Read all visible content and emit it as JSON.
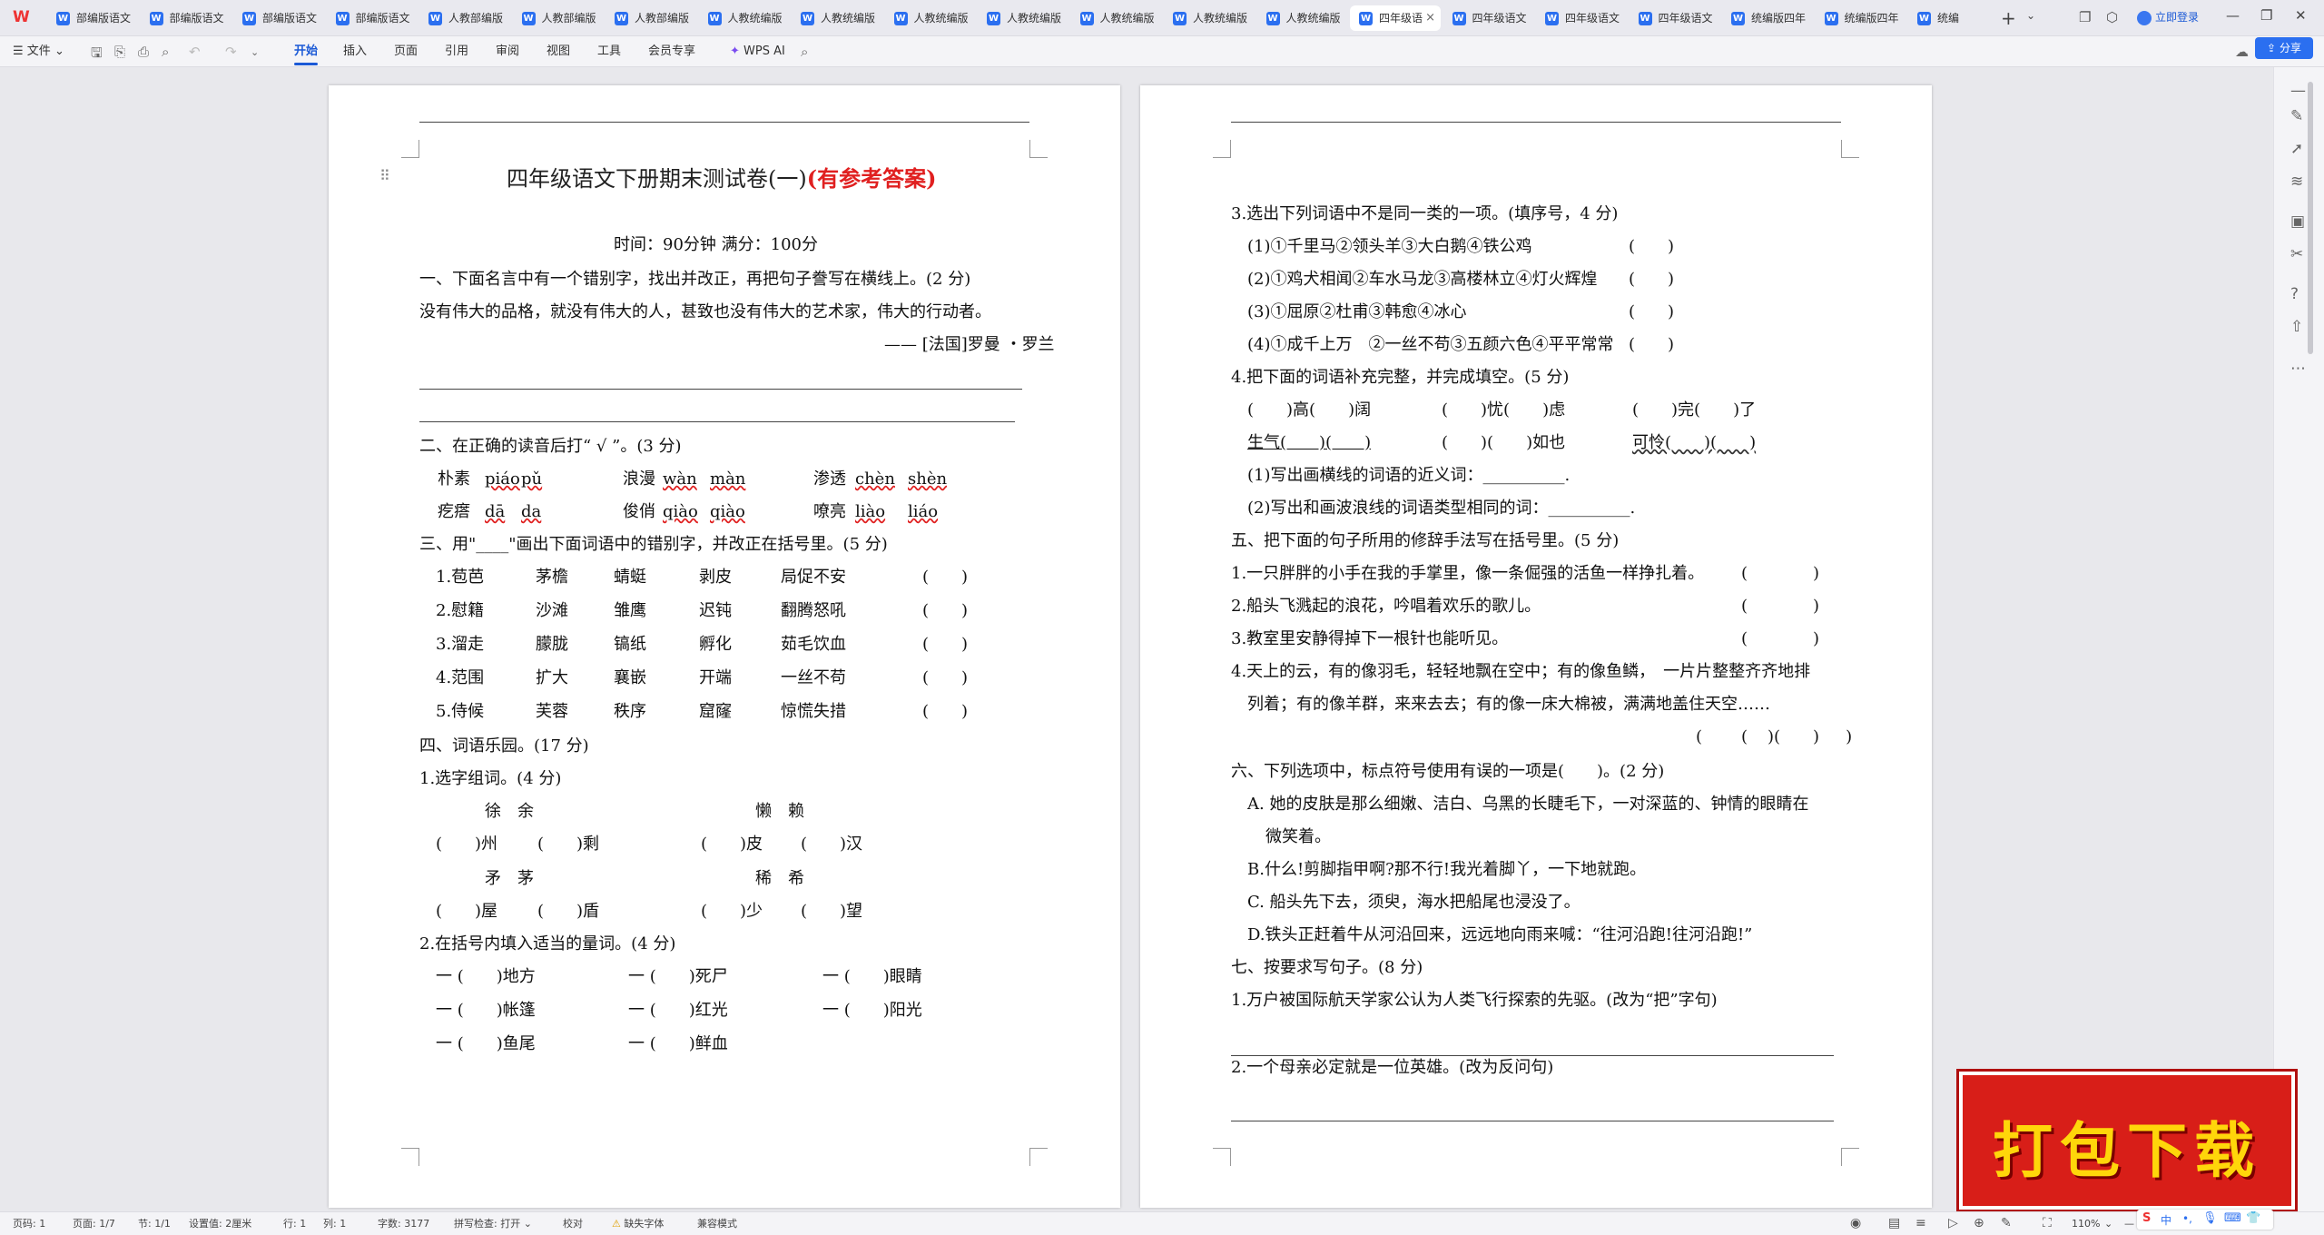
{
  "tabs": [
    {
      "label": "部编版语文"
    },
    {
      "label": "部编版语文"
    },
    {
      "label": "部编版语文"
    },
    {
      "label": "部编版语文"
    },
    {
      "label": "人教部编版"
    },
    {
      "label": "人教部编版"
    },
    {
      "label": "人教部编版"
    },
    {
      "label": "人教统编版"
    },
    {
      "label": "人教统编版"
    },
    {
      "label": "人教统编版"
    },
    {
      "label": "人教统编版"
    },
    {
      "label": "人教统编版"
    },
    {
      "label": "人教统编版"
    },
    {
      "label": "人教统编版"
    },
    {
      "label": "四年级语"
    },
    {
      "label": "四年级语文"
    },
    {
      "label": "四年级语文"
    },
    {
      "label": "四年级语文"
    },
    {
      "label": "统编版四年"
    },
    {
      "label": "统编版四年"
    },
    {
      "label": "统编"
    }
  ],
  "titlebar": {
    "login": "立即登录",
    "wps_icon": "wps-logo-icon"
  },
  "menu": {
    "file": "文件",
    "items": [
      "开始",
      "插入",
      "页面",
      "引用",
      "审阅",
      "视图",
      "工具",
      "会员专享"
    ],
    "ai": "WPS AI",
    "share": "分享",
    "active": "开始"
  },
  "doc": {
    "title_main": "四年级语文下册期末测试卷(一)",
    "title_red": "(有参考答案)",
    "time": "时间：90分钟  满分：100分",
    "left_lines": [
      "一、下面名言中有一个错别字，找出并改正，再把句子誊写在横线上。(2 分)",
      "没有伟大的品格，就没有伟大的人，甚致也没有伟大的艺术家，伟大的行动者。",
      "—— [法国]罗曼 ・罗兰",
      "二、在正确的读音后打“ √ ”。(3 分)",
      "三、用\"____\"画出下面词语中的错别字，并改正在括号里。(5 分)",
      "四、词语乐园。(17 分)",
      "1.选字组词。(4 分)",
      "2.在括号内填入适当的量词。(4 分)"
    ],
    "pinyin_row1": [
      "朴素",
      "piáo",
      "pǔ",
      "浪漫",
      "wàn",
      "màn",
      "渗透",
      "chèn",
      "shèn"
    ],
    "pinyin_row2": [
      "疙瘩",
      "dā",
      "da",
      "俊俏",
      "qiào",
      "qiào",
      "嘹亮",
      "liào",
      "liáo"
    ],
    "typo_rows": [
      [
        "1.苞芭",
        "茅檐",
        "蜻蜓",
        "剥皮",
        "局促不安",
        "(　　)"
      ],
      [
        "2.慰籍",
        "沙滩",
        "雏鹰",
        "迟钝",
        "翻腾怒吼",
        "(　　)"
      ],
      [
        "3.溜走",
        "朦胧",
        "镐纸",
        "孵化",
        "茹毛饮血",
        "(　　)"
      ],
      [
        "4.范围",
        "扩大",
        "襄嵌",
        "开端",
        "一丝不苟",
        "(　　)"
      ],
      [
        "5.侍候",
        "芙蓉",
        "秩序",
        "窟窿",
        "惊慌失措",
        "(　　)"
      ]
    ],
    "choose_groups": [
      {
        "chars": "徐　余",
        "items": [
          "(　　)州",
          "(　　)剩"
        ]
      },
      {
        "chars": "懒　赖",
        "items": [
          "(　　)皮",
          "(　　)汉"
        ]
      },
      {
        "chars": "矛　茅",
        "items": [
          "(　　)屋",
          "(　　)盾"
        ]
      },
      {
        "chars": "稀　希",
        "items": [
          "(　　)少",
          "(　　)望"
        ]
      }
    ],
    "measure_rows": [
      [
        "一 (　　)地方",
        "一 (　　)死尸",
        "一 (　　)眼睛"
      ],
      [
        "一 (　　)帐篷",
        "一 (　　)红光",
        "一 (　　)阳光"
      ],
      [
        "一 (　　)鱼尾",
        "一 (　　)鲜血"
      ]
    ],
    "right_lines": [
      "3.选出下列词语中不是同一类的一项。(填序号，4 分)",
      "(1)①千里马②领头羊③大白鹅④铁公鸡",
      "(2)①鸡犬相闻②车水马龙③高楼林立④灯火辉煌",
      "(3)①屈原②杜甫③韩愈④冰心",
      "(4)①成千上万　②一丝不苟③五颜六色④平平常常",
      "4.把下面的词语补充完整，并完成填空。(5 分)",
      "(　　)高(　　)阔",
      "(　　)忧(　　)虑",
      "(　　)完(　　)了",
      "生气(　　)(　　)",
      "(　　)(　　)如也",
      "可怜(　　)(　　)",
      "(1)写出画横线的词语的近义词：__________.",
      "(2)写出和画波浪线的词语类型相同的词：__________.",
      "五、把下面的句子所用的修辞手法写在括号里。(5 分)",
      "1.一只胖胖的小手在我的手掌里，像一条倔强的活鱼一样挣扎着。",
      "2.船头飞溅起的浪花，吟唱着欢乐的歌儿。",
      "3.教室里安静得掉下一根针也能听见。",
      "4.天上的云，有的像羽毛，轻轻地飘在空中；有的像鱼鳞，　一片片整整齐齐地排",
      "列着；有的像羊群，来来去去；有的像一床大棉被，满满地盖住天空……",
      "六、下列选项中，标点符号使用有误的一项是(　　)。(2 分)",
      "A. 她的皮肤是那么细嫩、洁白、乌黑的长睫毛下，一对深蓝的、钟情的眼睛在",
      "微笑着。",
      "B.什么!剪脚指甲啊?那不行!我光着脚丫，一下地就跑。",
      "C. 船头先下去，须臾，海水把船尾也浸没了。",
      "D.铁头正赶着牛从河沿回来，远远地向雨来喊：“往河沿跑!往河沿跑!”",
      "七、按要求写句子。(8 分)",
      "1.万户被国际航天学家公认为人类飞行探索的先驱。(改为“把”字句)",
      "2.一个母亲必定就是一位英雄。(改为反问句)"
    ],
    "paren": "(　　　　)",
    "paren_pair": "(　　　　)(　　　　)",
    "paren_q3": "(　　)"
  },
  "status": {
    "page": "页码: 1",
    "pages": "页面: 1/7",
    "section": "节: 1/1",
    "setting": "设置值: 2厘米",
    "row": "行: 1",
    "col": "列: 1",
    "words": "字数: 3177",
    "spell": "拼写检查: 打开",
    "proof": "校对",
    "font_missing": "缺失字体",
    "compat": "兼容模式",
    "zoom": "110%"
  },
  "promo": {
    "text": "打包下载"
  }
}
